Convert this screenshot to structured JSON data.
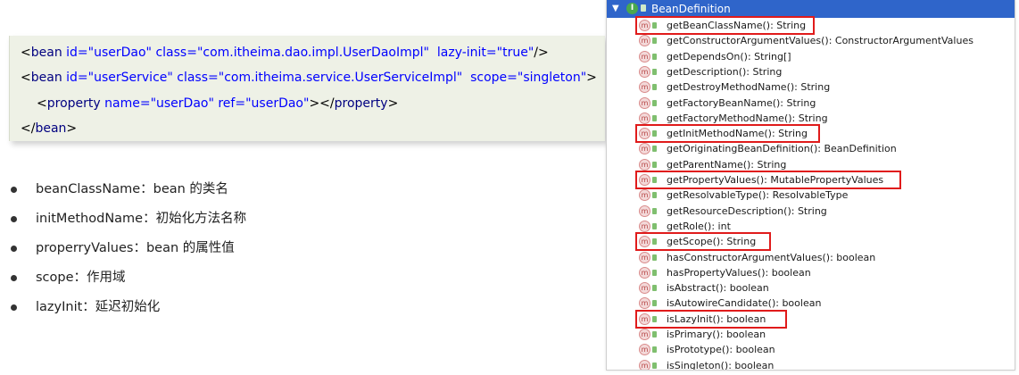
{
  "xml_code": {
    "line1": {
      "open": "<",
      "tag": "bean",
      "a1": "id=",
      "v1": "\"userDao\"",
      "a2": "class=",
      "v2": "\"com.itheima.dao.impl.UserDaoImpl\"",
      "a3": "lazy-init=",
      "v3": "\"true\"",
      "close": "/>"
    },
    "line2": {
      "open": "<",
      "tag": "bean",
      "a1": "id=",
      "v1": "\"userService\"",
      "a2": "class=",
      "v2": "\"com.itheima.service.UserServiceImpl\"",
      "a3": "scope=",
      "v3": "\"singleton\"",
      "close": ">"
    },
    "line3": {
      "open": "<",
      "tag": "property",
      "a1": "name=",
      "v1": "\"userDao\"",
      "a2": "ref=",
      "v2": "\"userDao\"",
      "mid": "></",
      "tag2": "property",
      "close": ">"
    },
    "line4": {
      "open": "</",
      "tag": "bean",
      "close": ">"
    }
  },
  "bullets": [
    "beanClassName：bean 的类名",
    "initMethodName：初始化方法名称",
    "properryValues：bean 的属性值",
    "scope：作用域",
    "lazyInit：延迟初始化"
  ],
  "panel": {
    "header_title": "BeanDefinition",
    "method_icon_letter": "m",
    "methods": [
      "getBeanClassName(): String",
      "getConstructorArgumentValues(): ConstructorArgumentValues",
      "getDependsOn(): String[]",
      "getDescription(): String",
      "getDestroyMethodName(): String",
      "getFactoryBeanName(): String",
      "getFactoryMethodName(): String",
      "getInitMethodName(): String",
      "getOriginatingBeanDefinition(): BeanDefinition",
      "getParentName(): String",
      "getPropertyValues(): MutablePropertyValues",
      "getResolvableType(): ResolvableType",
      "getResourceDescription(): String",
      "getRole(): int",
      "getScope(): String",
      "hasConstructorArgumentValues(): boolean",
      "hasPropertyValues(): boolean",
      "isAbstract(): boolean",
      "isAutowireCandidate(): boolean",
      "isLazyInit(): boolean",
      "isPrimary(): boolean",
      "isPrototype(): boolean",
      "isSingleton(): boolean"
    ],
    "highlighted": [
      0,
      7,
      10,
      14,
      19
    ],
    "highlight_color": "#e01b1b",
    "header_color": "#2f65ca"
  }
}
